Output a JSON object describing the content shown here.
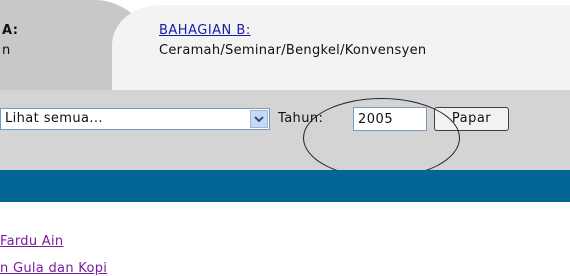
{
  "tabs": {
    "a": {
      "label": "A:",
      "sub": "n"
    },
    "b": {
      "title": "BAHAGIAN B:",
      "sub": "Ceramah/Seminar/Bengkel/Konvensyen"
    }
  },
  "filter": {
    "select_value": "Lihat semua...",
    "year_label": "Tahun:",
    "year_value": "2005",
    "submit_label": "Papar"
  },
  "list": {
    "items": [
      "Fardu Ain",
      "n Gula dan Kopi"
    ]
  },
  "colors": {
    "header_bar": "#026593",
    "link": "#7a1ba0",
    "tab_link": "#1a1aaa"
  },
  "icons": {
    "dropdown": "chevron-down-icon"
  }
}
